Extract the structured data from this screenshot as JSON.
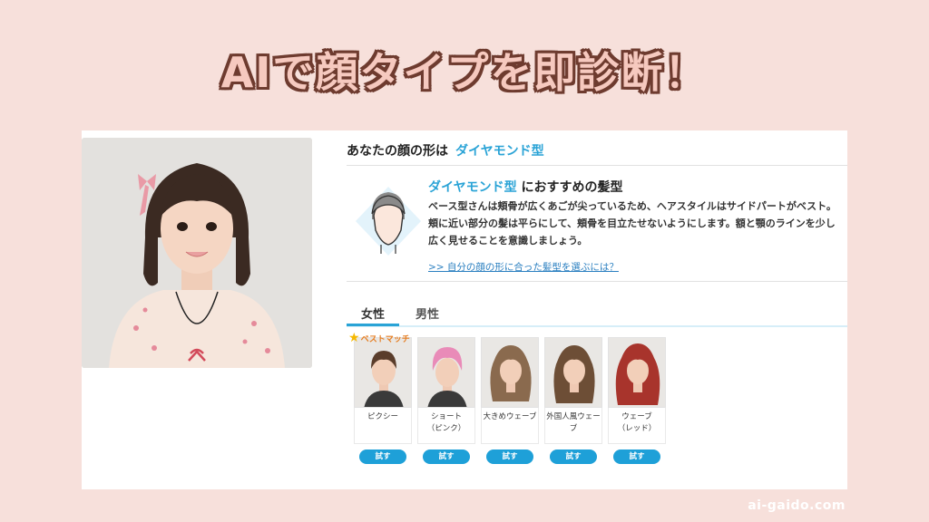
{
  "headline": "AIで顔タイプを即診断！",
  "result": {
    "prefix": "あなたの顔の形は",
    "face_type": "ダイヤモンド型"
  },
  "recommendation": {
    "type_name": "ダイヤモンド型",
    "title_suffix": "におすすめの髪型",
    "body": "ベース型さんは頬骨が広くあごが尖っているため、ヘアスタイルはサイドパートがベスト。頬に近い部分の髪は平らにして、頬骨を目立たせないようにします。額と顎のラインを少し広く見せることを意識しましょう。",
    "link": ">> 自分の顔の形に合った髪型を選ぶには？"
  },
  "tabs": [
    {
      "label": "女性",
      "active": true
    },
    {
      "label": "男性",
      "active": false
    }
  ],
  "styles": [
    {
      "label": "ピクシー",
      "button": "試す",
      "badge": "ベストマッチ",
      "hair": "#5a3d2b",
      "kind": "short"
    },
    {
      "label": "ショート\n（ピンク）",
      "button": "試す",
      "hair": "#e98bb8",
      "kind": "short"
    },
    {
      "label": "大きめウェーブ",
      "button": "試す",
      "hair": "#8a6a4e",
      "kind": "long"
    },
    {
      "label": "外国人風ウェーブ",
      "button": "試す",
      "hair": "#6d4e36",
      "kind": "long"
    },
    {
      "label": "ウェーブ\n（レッド）",
      "button": "試す",
      "hair": "#a8342c",
      "kind": "long"
    }
  ],
  "footer": {
    "domain": "ai-gaido.com"
  },
  "colors": {
    "accent": "#29a3d6",
    "button": "#1ea0d8",
    "background": "#f7e0db",
    "badge": "#e67e22"
  }
}
